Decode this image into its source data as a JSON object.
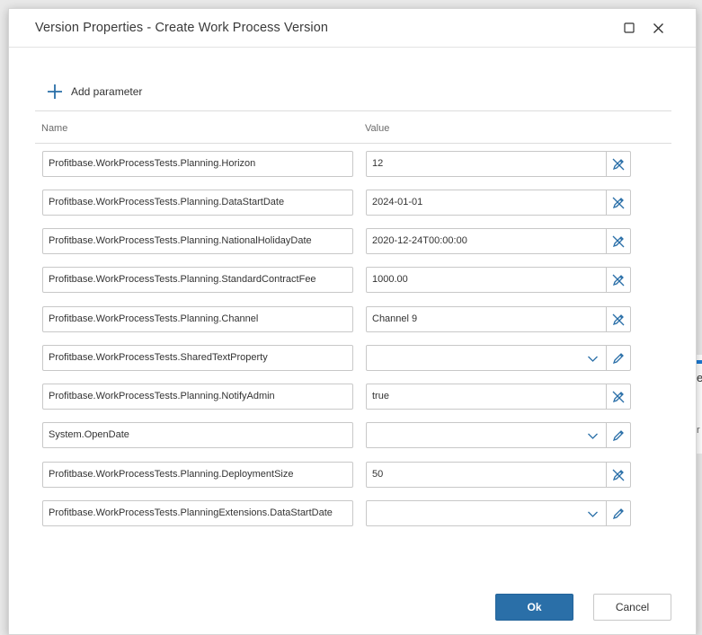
{
  "dialog": {
    "title": "Version Properties - Create Work Process Version",
    "add_parameter_label": "Add parameter",
    "columns": {
      "name": "Name",
      "value": "Value"
    },
    "ok_label": "Ok",
    "cancel_label": "Cancel",
    "accent_color": "#2a6fa8",
    "icon_color": "#2a6fa8"
  },
  "parameters": [
    {
      "name": "Profitbase.WorkProcessTests.Planning.Horizon",
      "value": "12",
      "kind": "text",
      "action_icon": "reset-edit-icon"
    },
    {
      "name": "Profitbase.WorkProcessTests.Planning.DataStartDate",
      "value": "2024-01-01",
      "kind": "text",
      "action_icon": "reset-edit-icon"
    },
    {
      "name": "Profitbase.WorkProcessTests.Planning.NationalHolidayDate",
      "value": "2020-12-24T00:00:00",
      "kind": "text",
      "action_icon": "reset-edit-icon"
    },
    {
      "name": "Profitbase.WorkProcessTests.Planning.StandardContractFee",
      "value": "1000.00",
      "kind": "text",
      "action_icon": "reset-edit-icon"
    },
    {
      "name": "Profitbase.WorkProcessTests.Planning.Channel",
      "value": "Channel 9",
      "kind": "text",
      "action_icon": "reset-edit-icon"
    },
    {
      "name": "Profitbase.WorkProcessTests.SharedTextProperty",
      "value": "",
      "kind": "dropdown",
      "action_icon": "pencil-icon"
    },
    {
      "name": "Profitbase.WorkProcessTests.Planning.NotifyAdmin",
      "value": "true",
      "kind": "text",
      "action_icon": "reset-edit-icon"
    },
    {
      "name": "System.OpenDate",
      "value": "",
      "kind": "dropdown",
      "action_icon": "pencil-icon"
    },
    {
      "name": "Profitbase.WorkProcessTests.Planning.DeploymentSize",
      "value": "50",
      "kind": "text",
      "action_icon": "reset-edit-icon"
    },
    {
      "name": "Profitbase.WorkProcessTests.PlanningExtensions.DataStartDate",
      "value": "",
      "kind": "dropdown",
      "action_icon": "pencil-icon"
    }
  ],
  "background": {
    "partial_text_1": "e",
    "partial_text_2": "r"
  }
}
